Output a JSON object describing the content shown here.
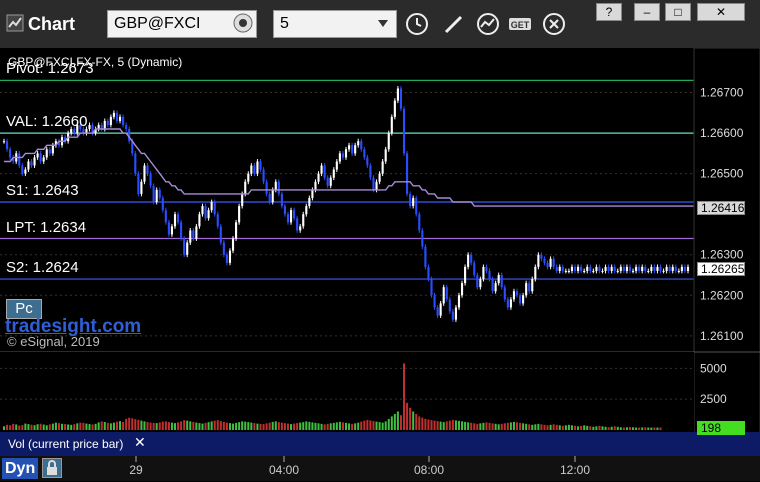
{
  "toolbar": {
    "title": "Chart",
    "symbol": "GBP@FXCI",
    "interval": "5",
    "window_buttons": [
      "?",
      "–",
      "□",
      "✕"
    ],
    "get_label": "GET"
  },
  "study_title": "GBP@FXCI,FX-FX, 5 (Dynamic)",
  "watermark": "tradesight.com",
  "copyright": "© eSignal, 2019",
  "pc_label": "Pc",
  "vol_label": "Vol (current price bar)",
  "vol_close": "✕",
  "dyn_label": "Dyn",
  "levels": [
    {
      "label": "Pivot: 1.2673",
      "value": 1.2673,
      "color": "#22aa55"
    },
    {
      "label": "VAL: 1.2660",
      "value": 1.266,
      "color": "#66e0c8"
    },
    {
      "label": "S1: 1.2643",
      "value": 1.2643,
      "color": "#3b5bff"
    },
    {
      "label": "LPT: 1.2634",
      "value": 1.2634,
      "color": "#a06ad4"
    },
    {
      "label": "S2: 1.2624",
      "value": 1.2624,
      "color": "#3b5bff"
    }
  ],
  "chart_data": {
    "type": "line",
    "title": "GBP@FXCI",
    "price_axis": {
      "ticks": [
        "1.26700",
        "1.26600",
        "1.26500",
        "1.26300",
        "1.26200",
        "1.26100"
      ],
      "ylim": [
        1.2607,
        1.268
      ]
    },
    "volume_axis": {
      "ticks": [
        "5000",
        "2500"
      ],
      "ylim": [
        0,
        6000
      ]
    },
    "time_axis": {
      "ticks": [
        "29",
        "04:00",
        "08:00",
        "12:00"
      ]
    },
    "last_price_tag": "1.26265",
    "ma_tag": "1.26416",
    "volume_tag": "198",
    "colors": {
      "up": "#ffffff",
      "down": "#2a4dff",
      "ma": "#a88bd6",
      "volume_up": "#40c040",
      "volume_down": "#c03030"
    },
    "x": [
      0,
      1,
      2,
      3,
      4,
      5,
      6,
      7,
      8,
      9,
      10,
      11,
      12,
      13,
      14,
      15,
      16,
      17,
      18,
      19,
      20,
      21,
      22,
      23,
      24,
      25,
      26,
      27,
      28,
      29,
      30,
      31,
      32,
      33,
      34,
      35,
      36,
      37,
      38,
      39,
      40,
      41,
      42,
      43,
      44,
      45,
      46,
      47,
      48,
      49,
      50,
      51,
      52,
      53,
      54,
      55,
      56,
      57,
      58,
      59,
      60,
      61,
      62,
      63,
      64,
      65,
      66,
      67,
      68,
      69,
      70,
      71,
      72,
      73,
      74,
      75,
      76,
      77,
      78,
      79,
      80,
      81,
      82,
      83,
      84,
      85,
      86,
      87,
      88,
      89,
      90,
      91,
      92,
      93,
      94,
      95,
      96,
      97,
      98,
      99,
      100,
      101,
      102,
      103,
      104,
      105,
      106,
      107,
      108,
      109,
      110,
      111,
      112,
      113,
      114,
      115,
      116,
      117,
      118,
      119,
      120,
      121,
      122,
      123,
      124,
      125,
      126,
      127,
      128,
      129,
      130,
      131,
      132,
      133,
      134,
      135,
      136,
      137,
      138,
      139,
      140,
      141,
      142,
      143,
      144,
      145,
      146,
      147,
      148,
      149,
      150,
      151,
      152,
      153,
      154,
      155,
      156,
      157,
      158,
      159,
      160,
      161,
      162,
      163,
      164,
      165,
      166,
      167,
      168,
      169,
      170,
      171,
      172,
      173,
      174,
      175,
      176,
      177,
      178,
      179,
      180,
      181,
      182,
      183,
      184,
      185,
      186,
      187,
      188,
      189,
      190,
      191,
      192,
      193,
      194,
      195,
      196,
      197,
      198,
      199,
      200,
      201,
      202,
      203,
      204,
      205,
      206,
      207,
      208,
      209,
      210,
      211,
      212,
      213,
      214,
      215,
      216,
      217,
      218,
      219,
      220,
      221,
      222,
      223,
      224
    ],
    "close": [
      1.2658,
      1.2656,
      1.2654,
      1.2653,
      1.2655,
      1.2652,
      1.265,
      1.2651,
      1.2653,
      1.2652,
      1.2654,
      1.2655,
      1.2653,
      1.2654,
      1.2656,
      1.2655,
      1.2657,
      1.2658,
      1.2657,
      1.2659,
      1.2658,
      1.266,
      1.2661,
      1.266,
      1.2662,
      1.2661,
      1.266,
      1.2661,
      1.2662,
      1.266,
      1.2661,
      1.2662,
      1.2661,
      1.2663,
      1.2662,
      1.2664,
      1.2665,
      1.2663,
      1.2664,
      1.2662,
      1.2661,
      1.2658,
      1.2655,
      1.265,
      1.2645,
      1.2648,
      1.2652,
      1.265,
      1.2647,
      1.2643,
      1.2646,
      1.2644,
      1.2641,
      1.2638,
      1.2635,
      1.2637,
      1.264,
      1.2638,
      1.2634,
      1.263,
      1.2633,
      1.2636,
      1.2634,
      1.2637,
      1.264,
      1.2642,
      1.2639,
      1.2641,
      1.2643,
      1.264,
      1.2637,
      1.2633,
      1.263,
      1.2628,
      1.2631,
      1.2634,
      1.2638,
      1.2642,
      1.2645,
      1.2648,
      1.265,
      1.2652,
      1.265,
      1.2653,
      1.2651,
      1.2648,
      1.2645,
      1.2643,
      1.2646,
      1.2648,
      1.2645,
      1.2642,
      1.264,
      1.2638,
      1.2641,
      1.2639,
      1.2636,
      1.2637,
      1.264,
      1.2642,
      1.2644,
      1.2646,
      1.2648,
      1.265,
      1.2652,
      1.2649,
      1.2647,
      1.2649,
      1.2651,
      1.2653,
      1.2655,
      1.2654,
      1.2656,
      1.2657,
      1.2655,
      1.2657,
      1.2658,
      1.2656,
      1.2654,
      1.2652,
      1.2649,
      1.2646,
      1.2648,
      1.265,
      1.2653,
      1.2656,
      1.266,
      1.2664,
      1.2668,
      1.2671,
      1.2666,
      1.2655,
      1.2645,
      1.2642,
      1.2644,
      1.264,
      1.2636,
      1.2632,
      1.2627,
      1.2624,
      1.262,
      1.2617,
      1.2615,
      1.2618,
      1.2622,
      1.2619,
      1.2616,
      1.2614,
      1.2617,
      1.262,
      1.2623,
      1.2627,
      1.263,
      1.2628,
      1.2625,
      1.2622,
      1.2624,
      1.2627,
      1.2626,
      1.2624,
      1.2621,
      1.2623,
      1.2625,
      1.2622,
      1.2619,
      1.2617,
      1.2619,
      1.2621,
      1.262,
      1.2618,
      1.262,
      1.2623,
      1.2621,
      1.2624,
      1.2627,
      1.263,
      1.2629,
      1.2628,
      1.2627,
      1.2629,
      1.2627,
      1.2626,
      1.2627,
      1.2626,
      1.2626,
      1.2626,
      1.2627,
      1.2626,
      1.2627,
      1.2626,
      1.2626,
      1.2627,
      1.2626,
      1.2626,
      1.2627,
      1.2626,
      1.2626,
      1.2627,
      1.2626,
      1.2627,
      1.2626,
      1.2626,
      1.2627,
      1.2626,
      1.2627,
      1.2626,
      1.2626,
      1.2627,
      1.2626,
      1.2627,
      1.2626,
      1.2626,
      1.2627,
      1.2626,
      1.2627,
      1.2626,
      1.2626,
      1.2627,
      1.2626,
      1.2627,
      1.2626,
      1.2626,
      1.2627,
      1.2626,
      1.2627
    ],
    "ma": [
      1.2653,
      1.2653,
      1.2653,
      1.2654,
      1.2654,
      1.2654,
      1.2654,
      1.2655,
      1.2655,
      1.2655,
      1.2655,
      1.2656,
      1.2656,
      1.2656,
      1.2657,
      1.2657,
      1.2657,
      1.2657,
      1.2658,
      1.2658,
      1.2658,
      1.2659,
      1.2659,
      1.2659,
      1.2659,
      1.266,
      1.266,
      1.266,
      1.266,
      1.266,
      1.2661,
      1.2661,
      1.2661,
      1.2661,
      1.2661,
      1.2661,
      1.2661,
      1.2661,
      1.2661,
      1.266,
      1.266,
      1.2659,
      1.2658,
      1.2657,
      1.2656,
      1.2655,
      1.2655,
      1.2654,
      1.2653,
      1.2652,
      1.2651,
      1.265,
      1.2649,
      1.2648,
      1.2648,
      1.2647,
      1.2647,
      1.2646,
      1.2646,
      1.2645,
      1.2645,
      1.2645,
      1.2645,
      1.2645,
      1.2645,
      1.2645,
      1.2645,
      1.2645,
      1.2645,
      1.2645,
      1.2645,
      1.2645,
      1.2645,
      1.2645,
      1.2645,
      1.2645,
      1.2645,
      1.2645,
      1.2645,
      1.2645,
      1.2645,
      1.2646,
      1.2646,
      1.2646,
      1.2646,
      1.2646,
      1.2646,
      1.2646,
      1.2646,
      1.2646,
      1.2646,
      1.2646,
      1.2646,
      1.2646,
      1.2646,
      1.2646,
      1.2646,
      1.2646,
      1.2646,
      1.2646,
      1.2646,
      1.2646,
      1.2646,
      1.2646,
      1.2646,
      1.2646,
      1.2646,
      1.2646,
      1.2646,
      1.2646,
      1.2646,
      1.2646,
      1.2646,
      1.2646,
      1.2646,
      1.2646,
      1.2646,
      1.2646,
      1.2646,
      1.2646,
      1.2646,
      1.2646,
      1.2646,
      1.2646,
      1.2646,
      1.2646,
      1.2647,
      1.2647,
      1.2648,
      1.2648,
      1.2648,
      1.2648,
      1.2648,
      1.2648,
      1.2647,
      1.2647,
      1.2647,
      1.2646,
      1.2646,
      1.2645,
      1.2645,
      1.2645,
      1.2644,
      1.2644,
      1.2644,
      1.2644,
      1.2644,
      1.2643,
      1.2643,
      1.2643,
      1.2643,
      1.2643,
      1.2643,
      1.2643,
      1.2642,
      1.2642,
      1.2642,
      1.2642,
      1.2642,
      1.2642,
      1.2642,
      1.2642,
      1.2642,
      1.2642,
      1.2642,
      1.2642,
      1.2642,
      1.2642,
      1.2642,
      1.2642,
      1.2642,
      1.2642,
      1.2642,
      1.2642,
      1.2642,
      1.2642,
      1.2642,
      1.2642,
      1.2642,
      1.2642,
      1.2642,
      1.2642,
      1.2642,
      1.2642,
      1.2642,
      1.2642,
      1.2642,
      1.2642,
      1.2642,
      1.2642,
      1.2642,
      1.2642,
      1.2642,
      1.2642,
      1.2642,
      1.2642,
      1.2642,
      1.2642,
      1.2642,
      1.2642,
      1.2642,
      1.2642,
      1.2642,
      1.2642,
      1.2642,
      1.2642,
      1.2642,
      1.2642,
      1.2642,
      1.2642,
      1.2642,
      1.2642,
      1.2642,
      1.2642,
      1.2642,
      1.2642,
      1.2642,
      1.2642,
      1.2642,
      1.2642,
      1.2642,
      1.2642,
      1.2642,
      1.2642,
      1.2642,
      1.2642,
      1.2642,
      1.2642
    ],
    "volume": [
      300,
      420,
      380,
      500,
      450,
      360,
      400,
      520,
      480,
      430,
      390,
      470,
      510,
      440,
      380,
      460,
      520,
      600,
      560,
      500,
      480,
      450,
      420,
      470,
      540,
      600,
      580,
      520,
      480,
      450,
      500,
      620,
      700,
      650,
      580,
      540,
      600,
      680,
      720,
      650,
      900,
      1000,
      950,
      880,
      820,
      760,
      700,
      650,
      600,
      580,
      560,
      620,
      680,
      700,
      640,
      600,
      560,
      620,
      700,
      800,
      760,
      700,
      650,
      600,
      560,
      520,
      580,
      640,
      700,
      760,
      800,
      720,
      660,
      600,
      560,
      520,
      580,
      640,
      700,
      680,
      640,
      600,
      560,
      520,
      500,
      480,
      540,
      600,
      660,
      700,
      640,
      600,
      560,
      520,
      480,
      520,
      560,
      600,
      640,
      700,
      660,
      620,
      580,
      540,
      500,
      460,
      500,
      540,
      580,
      620,
      660,
      620,
      580,
      540,
      500,
      540,
      600,
      680,
      760,
      820,
      780,
      720,
      680,
      640,
      600,
      700,
      900,
      1100,
      1300,
      1500,
      1200,
      5400,
      2200,
      1800,
      1500,
      1300,
      1100,
      1000,
      900,
      850,
      800,
      760,
      720,
      680,
      640,
      700,
      760,
      820,
      780,
      740,
      700,
      660,
      620,
      580,
      540,
      500,
      540,
      580,
      620,
      580,
      540,
      500,
      460,
      500,
      540,
      580,
      620,
      660,
      620,
      580,
      540,
      500,
      460,
      420,
      460,
      500,
      460,
      420,
      380,
      420,
      460,
      420,
      380,
      340,
      380,
      420,
      380,
      340,
      300,
      340,
      380,
      340,
      300,
      260,
      300,
      340,
      300,
      260,
      220,
      260,
      300,
      260,
      220,
      198,
      220,
      240,
      220,
      200,
      198,
      210,
      220,
      200,
      198,
      210,
      198,
      200
    ]
  }
}
